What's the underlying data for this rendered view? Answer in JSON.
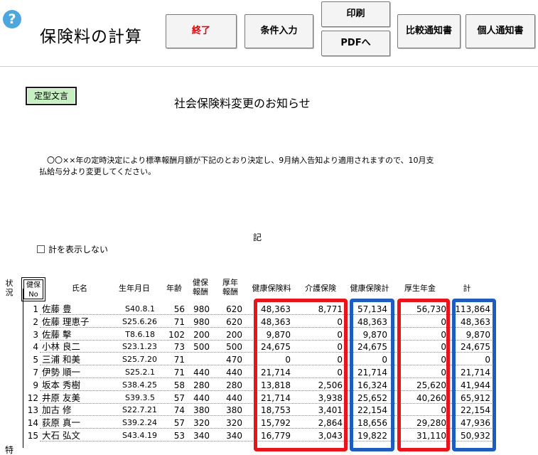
{
  "window": {
    "title": "保険料の計算",
    "help_icon": "?"
  },
  "toolbar": {
    "exit_label": "終了",
    "condition_label": "条件入力",
    "print_label": "印刷",
    "pdf_label": "PDFへ",
    "compare_label": "比較通知書",
    "personal_label": "個人通知書"
  },
  "notice": {
    "template_label": "定型文言",
    "title": "社会保険料変更のお知らせ",
    "body": "〇〇××年の定時決定により標準報酬月額が下記のとおり決定し、9月納入告知より適用されますので、10月支払給与分より変更してください。",
    "memo_mark": "記"
  },
  "options": {
    "hide_total_label": "計を表示しない",
    "hide_total_checked": false
  },
  "table": {
    "headers": {
      "status": [
        "状",
        "況"
      ],
      "no": [
        "健保",
        "No"
      ],
      "name": "氏名",
      "birth": "生年月日",
      "age": "年齢",
      "health_remuneration": [
        "健保",
        "報酬"
      ],
      "pension_remuneration": [
        "厚年",
        "報酬"
      ],
      "health_premium": "健康保険料",
      "care_premium": "介護保険",
      "health_total": "健康保険計",
      "pension_premium": "厚生年金",
      "total": "計"
    },
    "status_marks": [
      {
        "row": 12,
        "text": "特"
      }
    ],
    "rows": [
      {
        "no": "1",
        "name": "佐藤 豊",
        "birth": "S40.8.1",
        "age": "56",
        "health_rem": "980",
        "pension_rem": "620",
        "health_premium": "48,363",
        "care_premium": "8,771",
        "health_total": "57,134",
        "pension_premium": "56,730",
        "total": "113,864"
      },
      {
        "no": "2",
        "name": "佐藤 理恵子",
        "birth": "S25.6.26",
        "age": "71",
        "health_rem": "980",
        "pension_rem": "620",
        "health_premium": "48,363",
        "care_premium": "0",
        "health_total": "48,363",
        "pension_premium": "0",
        "total": "48,363"
      },
      {
        "no": "3",
        "name": "佐藤 擊",
        "birth": "T8.6.18",
        "age": "102",
        "health_rem": "200",
        "pension_rem": "200",
        "health_premium": "9,870",
        "care_premium": "0",
        "health_total": "9,870",
        "pension_premium": "0",
        "total": "9,870"
      },
      {
        "no": "4",
        "name": "小林 良二",
        "birth": "S23.1.23",
        "age": "73",
        "health_rem": "500",
        "pension_rem": "500",
        "health_premium": "24,675",
        "care_premium": "0",
        "health_total": "24,675",
        "pension_premium": "0",
        "total": "24,675"
      },
      {
        "no": "5",
        "name": "三浦 和美",
        "birth": "S25.7.20",
        "age": "71",
        "health_rem": "",
        "pension_rem": "470",
        "health_premium": "0",
        "care_premium": "0",
        "health_total": "0",
        "pension_premium": "0",
        "total": "0"
      },
      {
        "no": "7",
        "name": "伊勢 順一",
        "birth": "S25.2.1",
        "age": "71",
        "health_rem": "440",
        "pension_rem": "440",
        "health_premium": "21,714",
        "care_premium": "0",
        "health_total": "21,714",
        "pension_premium": "0",
        "total": "21,714"
      },
      {
        "no": "9",
        "name": "坂本 秀樹",
        "birth": "S38.4.25",
        "age": "58",
        "health_rem": "280",
        "pension_rem": "280",
        "health_premium": "13,818",
        "care_premium": "2,506",
        "health_total": "16,324",
        "pension_premium": "25,620",
        "total": "41,944"
      },
      {
        "no": "12",
        "name": "井原 友美",
        "birth": "S39.3.5",
        "age": "57",
        "health_rem": "440",
        "pension_rem": "440",
        "health_premium": "21,714",
        "care_premium": "3,938",
        "health_total": "25,652",
        "pension_premium": "40,260",
        "total": "65,912"
      },
      {
        "no": "13",
        "name": "加古 修",
        "birth": "S22.7.21",
        "age": "74",
        "health_rem": "380",
        "pension_rem": "380",
        "health_premium": "18,753",
        "care_premium": "3,401",
        "health_total": "22,154",
        "pension_premium": "0",
        "total": "22,154"
      },
      {
        "no": "14",
        "name": "荻原 真一",
        "birth": "S39.2.24",
        "age": "57",
        "health_rem": "320",
        "pension_rem": "320",
        "health_premium": "15,792",
        "care_premium": "2,864",
        "health_total": "18,656",
        "pension_premium": "29,280",
        "total": "47,936"
      },
      {
        "no": "15",
        "name": "大石 弘文",
        "birth": "S43.4.19",
        "age": "53",
        "health_rem": "340",
        "pension_rem": "340",
        "health_premium": "16,779",
        "care_premium": "3,043",
        "health_total": "19,822",
        "pension_premium": "31,110",
        "total": "50,932"
      }
    ]
  },
  "highlight_colors": {
    "red": "#e8141b",
    "blue": "#1f5dbd"
  }
}
